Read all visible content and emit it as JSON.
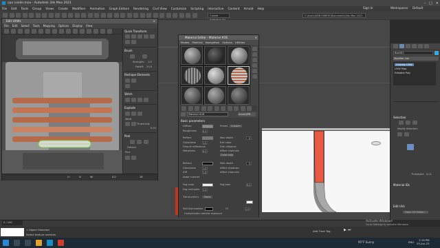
{
  "app": {
    "title": "cpu cooler.max - Autodesk 3ds Max 2021",
    "menu": [
      "File",
      "Edit",
      "Tools",
      "Group",
      "Views",
      "Create",
      "Modifiers",
      "Animation",
      "Graph Editors",
      "Rendering",
      "Civil View",
      "Customize",
      "Scripting",
      "Interactive",
      "Content",
      "Arnold",
      "Help"
    ],
    "select_set": "Create Selection Se",
    "path": "C:\\Users\\EDB HIMEYE\\Documents\\3ds Max 2021",
    "signin": "Sign In",
    "workspaces_label": "Workspaces:",
    "workspaces_value": "Default"
  },
  "uvw": {
    "title": "Edit UVWs",
    "menu": [
      "File",
      "Edit",
      "Select",
      "Tools",
      "Mapping",
      "Options",
      "Display",
      "View"
    ],
    "top_field": "Map #1 (J...",
    "top_value": "CheckerPattern",
    "status_values": [
      "U:",
      "V:",
      "W:",
      "0.0",
      "16"
    ],
    "side": {
      "quick_transform": "Quick Transform",
      "brush": "Brush",
      "strength_label": "Strength:",
      "strength_value": "1.0",
      "falloff_label": "Falloff:",
      "falloff_value": "20.0",
      "reshape": "Reshape Elements",
      "stitch": "Stitch",
      "explode": "Explode",
      "weld": "Weld",
      "threshold_label": "Threshold:",
      "threshold_value": "0.01",
      "peel": "Peel",
      "detach": "Detach",
      "pins": "Pins"
    }
  },
  "material": {
    "title": "Material Editor - Material #26",
    "menu": [
      "Modes",
      "Material",
      "Navigation",
      "Options",
      "Utilities"
    ],
    "name": "Material #26",
    "type": "Arnold/PB",
    "section": "Basic parameters",
    "diffuse": "Diffuse",
    "roughness": "Roughness",
    "preset_label": "Preset",
    "preset_value": "Custom",
    "reflect": "Reflect",
    "glossiness": "Glossiness",
    "fresnel": "Fresnel reflections",
    "metalness": "Metalness",
    "refract": "Refract",
    "ior": "IOR",
    "abbe": "Abbe number",
    "fog_color": "Fog color",
    "fog_multiplier": "Fog multiplier",
    "fog_bias": "Fog bias",
    "translucency": "Translucency",
    "translucency_value": "None",
    "self_illum": "Self-illumination",
    "compensate": "Compensate camera exposure",
    "max_depth": "Max depth",
    "exit_color": "Exit color",
    "dim_distance": "Dim distance",
    "affect_channels": "Affect channels",
    "affect_channels_value": "Color only",
    "affect_shadows": "Affect shadows",
    "values": {
      "roughness": "0.0",
      "reflect_glossiness": "1.0",
      "reflect_depth": "5",
      "ior": "1.6",
      "metalness": "0.0",
      "refract_glossiness": "1.0",
      "refract_ior": "1.6",
      "refract_depth": "5",
      "fog_mult": "1.0",
      "fog_bias": "0.0",
      "self_illum_mult": "1.0",
      "gi": "GI"
    }
  },
  "command_panel": {
    "object_name": "Box001",
    "modifier_list": "Modifier List",
    "stack": [
      "Unwrap UVW",
      "UVW Map",
      "Editable Poly"
    ],
    "selection": "Selection",
    "modify_selection": "Modify Selection",
    "threshold": "Threshold:",
    "threshold_value": "0.01",
    "material_ids": "Material IDs",
    "edit_uvs": "Edit UVs",
    "open_editor": "Open UV Editor..."
  },
  "status": {
    "line1": "1 Object Selected",
    "line2": "Select texture vertices",
    "frame": "0 / 100",
    "activate_line1": "Activate Windows",
    "activate_line2": "Go to Settings to activate Windows.",
    "time_tag": "Add Time Tag"
  },
  "taskbar": {
    "weather_temp": "95°F",
    "weather_desc": "Sunny",
    "lang": "ENG",
    "time": "2:19 PM",
    "date": "25-Jun-23"
  },
  "colors": {
    "accent_blue": "#5b84b1",
    "red_part": "#c4371d",
    "green_select": "#7cd33b"
  }
}
